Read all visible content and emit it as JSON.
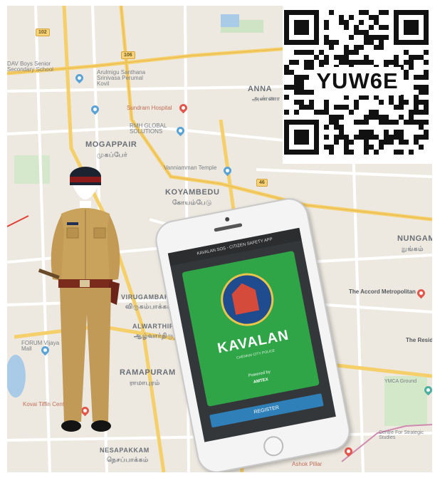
{
  "qr": {
    "code": "YUW6E"
  },
  "phone": {
    "header": "KAVALAN SOS - CITIZEN SAFETY APP",
    "app_name": "KAVALAN",
    "tagline": "CHENNAI CITY POLICE",
    "sponsor_line": "Powered by",
    "sponsor_name": "AMTEX",
    "button": "REGISTER"
  },
  "map": {
    "areas": [
      {
        "key": "mogappair",
        "text": "MOGAPPAIR",
        "ta": "முகப்பேர்"
      },
      {
        "key": "koyambedu",
        "text": "KOYAMBEDU",
        "ta": "கோயம்பேடு"
      },
      {
        "key": "ramapuram",
        "text": "RAMAPURAM",
        "ta": "ராமாபுரம்"
      },
      {
        "key": "anna",
        "text": "ANNA",
        "ta": "அண்ணா"
      },
      {
        "key": "nungam",
        "text": "NUNGAM",
        "ta": "நுங்கம்"
      },
      {
        "key": "virugambakkam",
        "text": "VIRUGAMBAKKAM",
        "ta": "விருகம்பாக்கம்"
      },
      {
        "key": "alwarthiru",
        "text": "ALWARTHIRUNAGAR",
        "ta": "ஆழ்வார்திருநகர்"
      },
      {
        "key": "nesapakkam",
        "text": "NESAPAKKAM",
        "ta": "நெசப்பாக்கம்"
      }
    ],
    "pois": [
      "DAV Boys Senior Secondary School",
      "Arulmigu Santhana Srinivasa Perumal Kovil",
      "Sundram Hospital",
      "RMH GLOBAL SOLUTIONS",
      "Vanniamman Temple",
      "The Accord Metropolitan",
      "The Residency",
      "YMCA Ground",
      "Centre For Strategic Studies",
      "Kovai Tiffin Centre",
      "FORUM Vijaya Mall",
      "Ashok Pillar"
    ],
    "road_shields": [
      "102",
      "106",
      "46"
    ]
  }
}
